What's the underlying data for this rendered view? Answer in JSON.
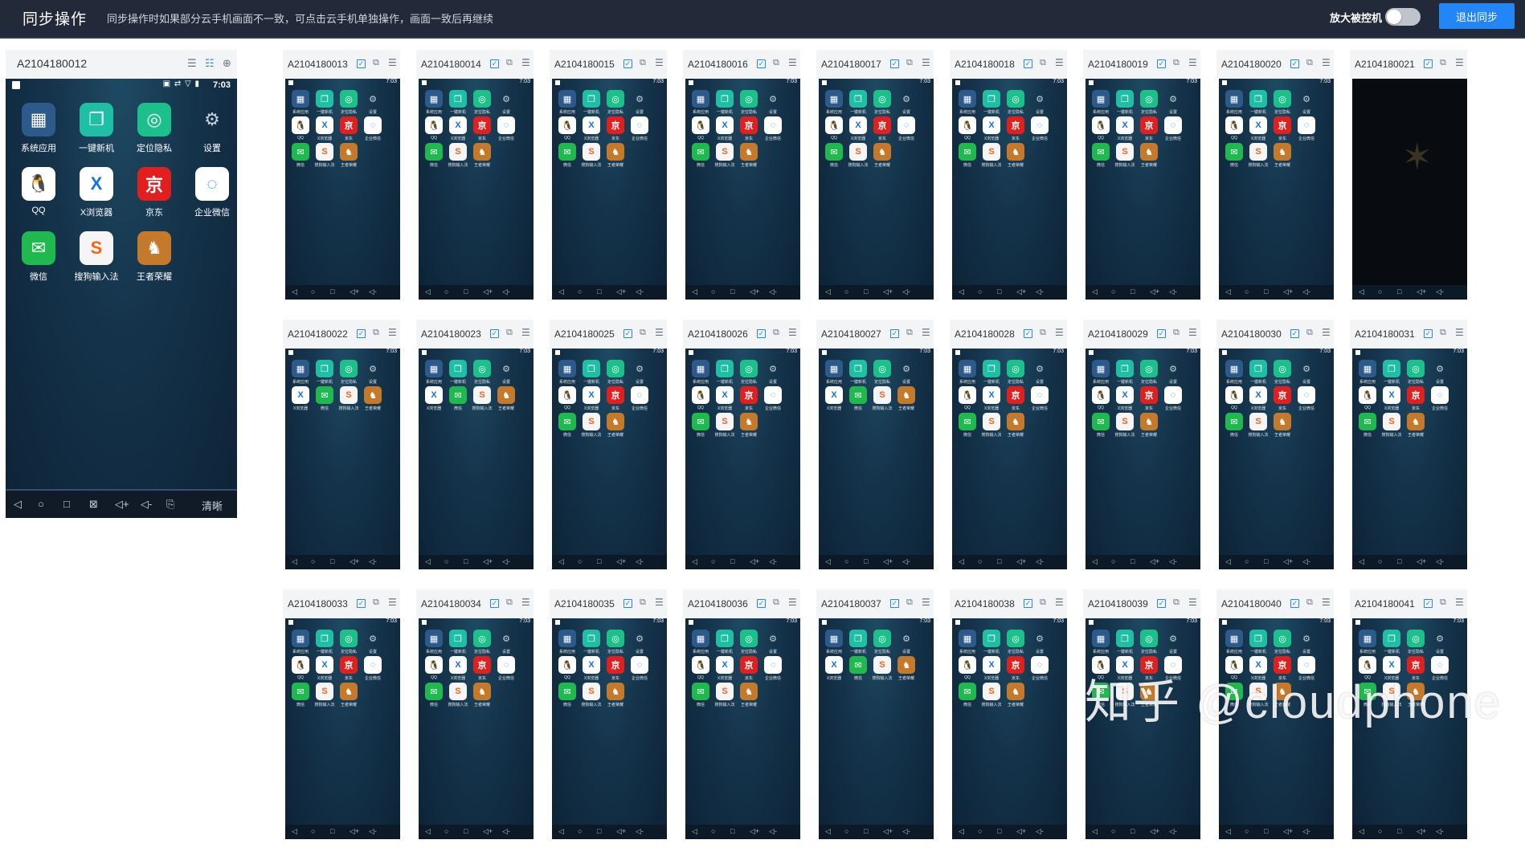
{
  "header": {
    "title": "同步操作",
    "hint": "同步操作时如果部分云手机画面不一致，可点击云手机单独操作，画面一致后再继续",
    "control_label": "放大被控机",
    "toggle_on": false,
    "exit_label": "退出同步"
  },
  "colors": {
    "header_bg": "#222a39",
    "accent": "#2386f6"
  },
  "master": {
    "id": "A2104180012",
    "header_icons": [
      "menu-icon",
      "checklist-icon",
      "zoom-in-icon"
    ],
    "time": "7:03",
    "apps": [
      {
        "label": "系统应用",
        "icon": "system-apps-icon",
        "glyph": "▦",
        "theme": "t-sys"
      },
      {
        "label": "一键新机",
        "icon": "new-device-icon",
        "glyph": "❐",
        "theme": "t-new"
      },
      {
        "label": "定位隐私",
        "icon": "location-icon",
        "glyph": "◎",
        "theme": "t-loc"
      },
      {
        "label": "设置",
        "icon": "gear-icon",
        "glyph": "⚙",
        "theme": "t-set"
      },
      {
        "label": "QQ",
        "icon": "qq-icon",
        "glyph": "🐧",
        "theme": "t-qq"
      },
      {
        "label": "X浏览器",
        "icon": "x-browser-icon",
        "glyph": "X",
        "theme": "t-x"
      },
      {
        "label": "京东",
        "icon": "jd-icon",
        "glyph": "京",
        "theme": "t-jd"
      },
      {
        "label": "企业微信",
        "icon": "wecom-icon",
        "glyph": "◌",
        "theme": "t-wx"
      },
      {
        "label": "微信",
        "icon": "wechat-icon",
        "glyph": "✉",
        "theme": "t-chat"
      },
      {
        "label": "搜狗输入法",
        "icon": "sogou-icon",
        "glyph": "S",
        "theme": "t-sg"
      },
      {
        "label": "王者荣耀",
        "icon": "game-icon",
        "glyph": "♞",
        "theme": "t-hok"
      }
    ],
    "nav_clear_label": "清晰"
  },
  "phones": [
    {
      "id": "A2104180013",
      "layout": "A"
    },
    {
      "id": "A2104180014",
      "layout": "A"
    },
    {
      "id": "A2104180015",
      "layout": "A"
    },
    {
      "id": "A2104180016",
      "layout": "A"
    },
    {
      "id": "A2104180017",
      "layout": "A"
    },
    {
      "id": "A2104180018",
      "layout": "A"
    },
    {
      "id": "A2104180019",
      "layout": "A"
    },
    {
      "id": "A2104180020",
      "layout": "A"
    },
    {
      "id": "A2104180021",
      "layout": "boot"
    },
    {
      "id": "A2104180022",
      "layout": "B"
    },
    {
      "id": "A2104180023",
      "layout": "B"
    },
    {
      "id": "A2104180025",
      "layout": "A"
    },
    {
      "id": "A2104180026",
      "layout": "A"
    },
    {
      "id": "A2104180027",
      "layout": "B"
    },
    {
      "id": "A2104180028",
      "layout": "A"
    },
    {
      "id": "A2104180029",
      "layout": "A"
    },
    {
      "id": "A2104180030",
      "layout": "A"
    },
    {
      "id": "A2104180031",
      "layout": "A"
    },
    {
      "id": "A2104180033",
      "layout": "A"
    },
    {
      "id": "A2104180034",
      "layout": "A"
    },
    {
      "id": "A2104180035",
      "layout": "A"
    },
    {
      "id": "A2104180036",
      "layout": "A"
    },
    {
      "id": "A2104180037",
      "layout": "B"
    },
    {
      "id": "A2104180038",
      "layout": "A"
    },
    {
      "id": "A2104180039",
      "layout": "A"
    },
    {
      "id": "A2104180040",
      "layout": "A"
    },
    {
      "id": "A2104180041",
      "layout": "A"
    }
  ],
  "phone_time": "7:03",
  "watermark": "知乎 @cloudphone"
}
